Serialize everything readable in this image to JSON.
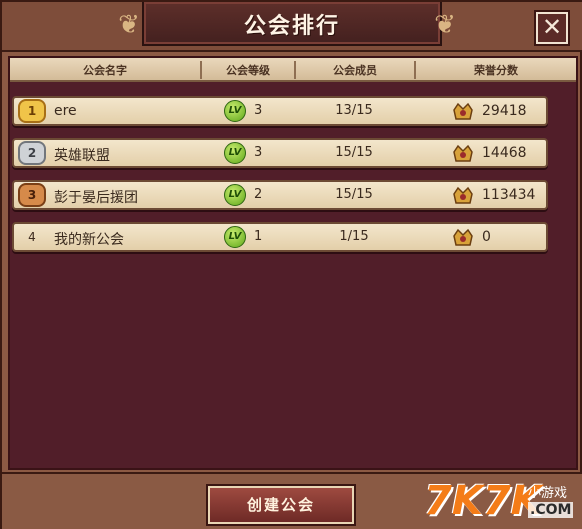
{
  "window": {
    "title": "公会排行",
    "close_label": "✕"
  },
  "table": {
    "headers": [
      "公会名字",
      "公会等级",
      "公会成员",
      "荣誉分数"
    ],
    "rows": [
      {
        "rank": "1",
        "badge": "gold",
        "name": "ere",
        "level": "3",
        "members": "13/15",
        "honor": "29418"
      },
      {
        "rank": "2",
        "badge": "silver",
        "name": "英雄联盟",
        "level": "3",
        "members": "15/15",
        "honor": "14468"
      },
      {
        "rank": "3",
        "badge": "bronze",
        "name": "彭于晏后援团",
        "level": "2",
        "members": "15/15",
        "honor": "113434"
      },
      {
        "rank": "4",
        "badge": "none",
        "name": "我的新公会",
        "level": "1",
        "members": "1/15",
        "honor": "0"
      }
    ],
    "level_icon_text": "LV"
  },
  "actions": {
    "create_label": "创建公会"
  },
  "watermark": {
    "brand": "7K7K",
    "sub": "小游戏",
    "domain": ".COM"
  },
  "colors": {
    "panel": "#511e29",
    "frame": "#8c5a44",
    "row": "#f3e6cc",
    "gold": "#f0c449",
    "silver": "#cfd2d6",
    "bronze": "#d68a4a",
    "lv_green": "#5ea71a"
  }
}
